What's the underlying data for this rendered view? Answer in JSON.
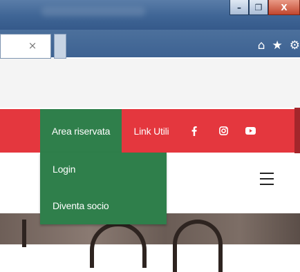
{
  "browser": {
    "url_close_glyph": "×",
    "window_buttons": {
      "minimize": "–",
      "maximize": "❐",
      "close": "X"
    },
    "toolbar_icons": [
      "home-icon",
      "star-icon",
      "gear-icon"
    ]
  },
  "nav": {
    "area_riservata": "Area riservata",
    "link_utili": "Link Utili",
    "social": [
      "facebook-icon",
      "instagram-icon",
      "youtube-icon"
    ],
    "colors": {
      "bar": "#e4373e",
      "active": "#2f7f4b"
    }
  },
  "dropdown": {
    "items": [
      {
        "label": "Login"
      },
      {
        "label": "Diventa socio"
      }
    ]
  },
  "header": {
    "menu_icon": "hamburger-menu-icon"
  }
}
